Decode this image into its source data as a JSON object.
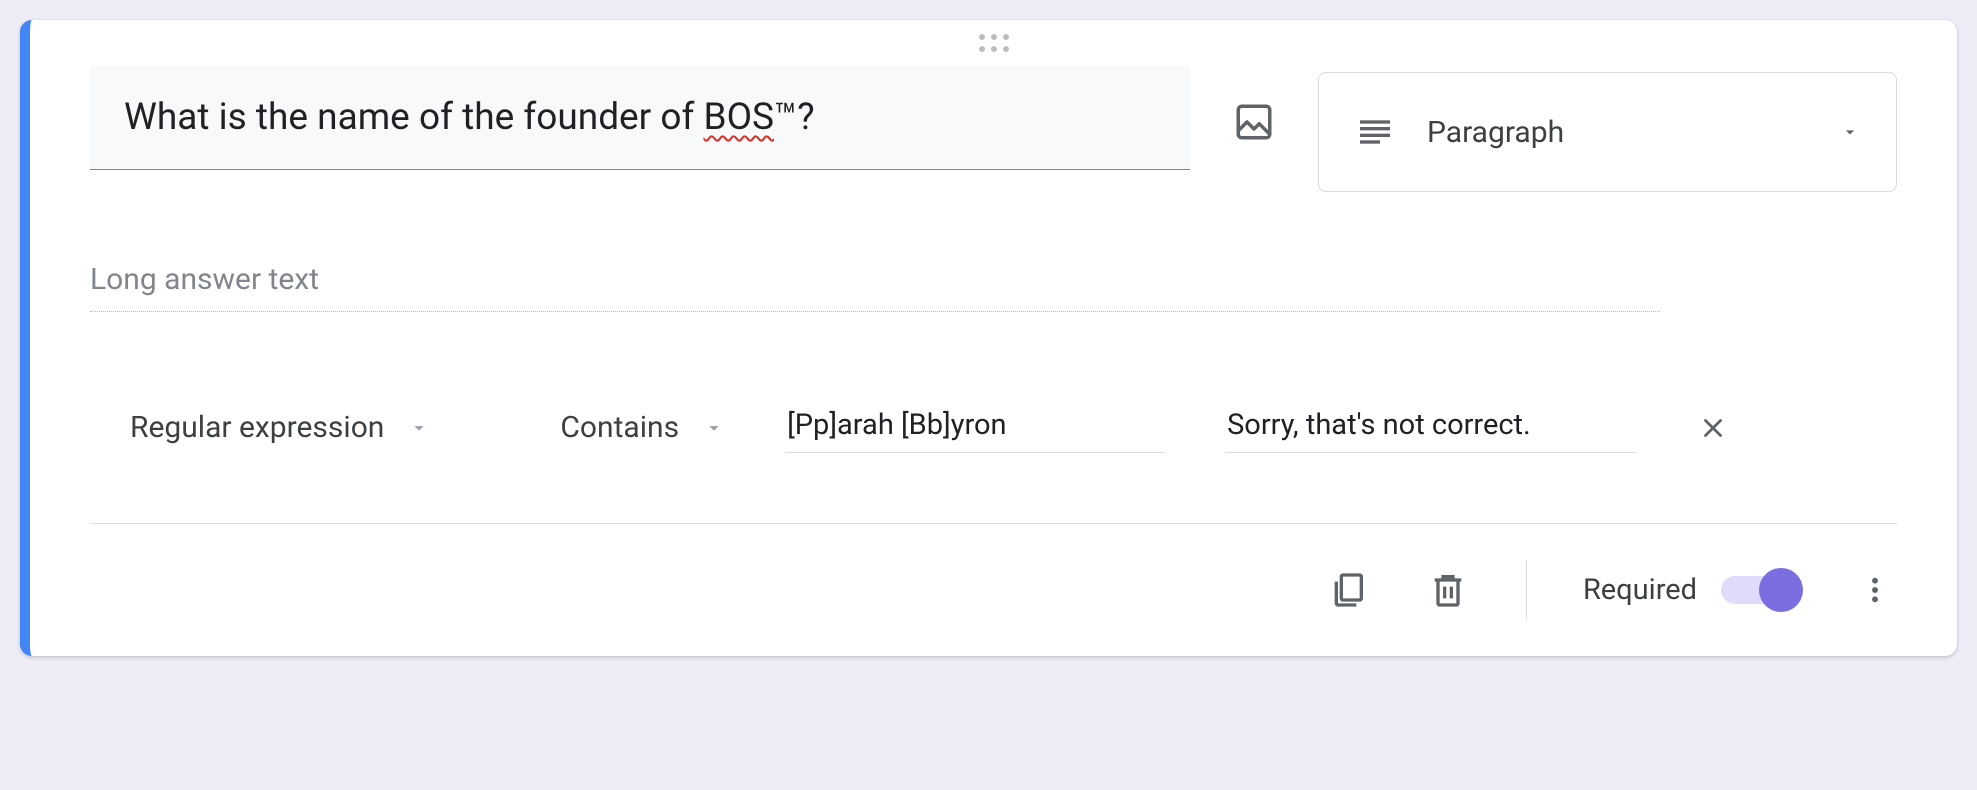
{
  "question": {
    "text_prefix": "What is the name of the founder of ",
    "text_spellcheck": "BOS",
    "text_suffix": "™?"
  },
  "question_type": {
    "selected_label": "Paragraph"
  },
  "answer": {
    "placeholder_label": "Long answer text"
  },
  "validation": {
    "rule_type": "Regular expression",
    "condition": "Contains",
    "pattern": "[Pp]arah [Bb]yron",
    "error_message": "Sorry, that's not correct."
  },
  "footer": {
    "required_label": "Required",
    "required_on": true
  }
}
